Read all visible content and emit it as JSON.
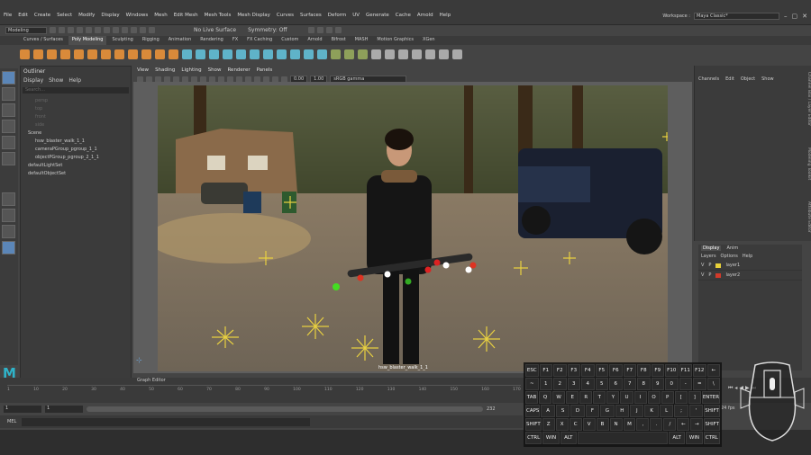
{
  "menubar": {
    "items": [
      "File",
      "Edit",
      "Create",
      "Select",
      "Modify",
      "Display",
      "Windows",
      "Mesh",
      "Edit Mesh",
      "Mesh Tools",
      "Mesh Display",
      "Curves",
      "Surfaces",
      "Deform",
      "UV",
      "Generate",
      "Cache",
      "Arnold",
      "Help"
    ],
    "workspace_label": "Workspace :",
    "workspace_value": "Maya Classic*"
  },
  "statusline": {
    "mode": "Modeling",
    "live_surface": "No Live Surface",
    "symmetry": "Symmetry: Off"
  },
  "shelf_tabs": [
    "Curves / Surfaces",
    "Poly Modeling",
    "Sculpting",
    "Rigging",
    "Animation",
    "Rendering",
    "FX",
    "FX Caching",
    "Custom",
    "Arnold",
    "Bifrost",
    "MASH",
    "Motion Graphics",
    "XGen"
  ],
  "shelf_active": "Poly Modeling",
  "outliner": {
    "title": "Outliner",
    "menu": [
      "Display",
      "Show",
      "Help"
    ],
    "search_placeholder": "Search...",
    "items": [
      {
        "label": "persp",
        "dim": true,
        "indent": 1
      },
      {
        "label": "top",
        "dim": true,
        "indent": 1
      },
      {
        "label": "front",
        "dim": true,
        "indent": 1
      },
      {
        "label": "side",
        "dim": true,
        "indent": 1
      },
      {
        "label": "Scene",
        "dim": false,
        "indent": 0
      },
      {
        "label": "hsw_blaster_walk_1_1",
        "dim": false,
        "indent": 1
      },
      {
        "label": "cameraPGroup_pgroup_1_1",
        "dim": false,
        "indent": 1
      },
      {
        "label": "objectPGroup_pgroup_2_1_1",
        "dim": false,
        "indent": 1
      },
      {
        "label": "defaultLightSet",
        "dim": false,
        "indent": 0
      },
      {
        "label": "defaultObjectSet",
        "dim": false,
        "indent": 0
      }
    ]
  },
  "viewport": {
    "menu": [
      "View",
      "Shading",
      "Lighting",
      "Show",
      "Renderer",
      "Panels"
    ],
    "exposure": "0.00",
    "gamma": "1.00",
    "colorspace": "sRGB gamma",
    "camera_label": "hsw_blaster_walk_1_1"
  },
  "channels": {
    "menu": [
      "Channels",
      "Edit",
      "Object",
      "Show"
    ]
  },
  "layers": {
    "tabs": [
      "Display",
      "Anim"
    ],
    "menu": [
      "Layers",
      "Options",
      "Help"
    ],
    "rows": [
      {
        "v": "V",
        "p": "P",
        "name": "layer1",
        "color": "#e8d13a"
      },
      {
        "v": "V",
        "p": "P",
        "name": "layer2",
        "color": "#d23a2a"
      }
    ]
  },
  "side_tabs": [
    "Channel Box / Layer Editor",
    "Modeling Toolkit",
    "Attribute Editor"
  ],
  "timeline": {
    "graph_editor_label": "Graph Editor",
    "ticks": [
      "1",
      "10",
      "20",
      "30",
      "40",
      "50",
      "60",
      "70",
      "80",
      "90",
      "100",
      "110",
      "120",
      "130",
      "140",
      "150",
      "160",
      "170"
    ],
    "range_start": "1",
    "range_start2": "1",
    "range_end": "232",
    "fps": "24 fps",
    "mel": "MEL"
  },
  "keyboard": {
    "rows": [
      [
        "ESC",
        "F1",
        "F2",
        "F3",
        "F4",
        "F5",
        "F6",
        "F7",
        "F8",
        "F9",
        "F10",
        "F11",
        "F12",
        "←"
      ],
      [
        "~",
        "1",
        "2",
        "3",
        "4",
        "5",
        "6",
        "7",
        "8",
        "9",
        "0",
        "-",
        "=",
        "\\"
      ],
      [
        "TAB",
        "Q",
        "W",
        "E",
        "R",
        "T",
        "Y",
        "U",
        "I",
        "O",
        "P",
        "[",
        "]",
        "ENTER"
      ],
      [
        "CAPS",
        "A",
        "S",
        "D",
        "F",
        "G",
        "H",
        "J",
        "K",
        "L",
        ";",
        "'",
        "SHIFT"
      ],
      [
        "SHIFT",
        "Z",
        "X",
        "C",
        "V",
        "B",
        "N",
        "M",
        ",",
        ".",
        "/",
        "←",
        "→",
        "SHIFT"
      ],
      [
        "CTRL",
        "WIN",
        "ALT",
        "",
        "ALT",
        "WIN",
        "CTRL"
      ]
    ]
  }
}
